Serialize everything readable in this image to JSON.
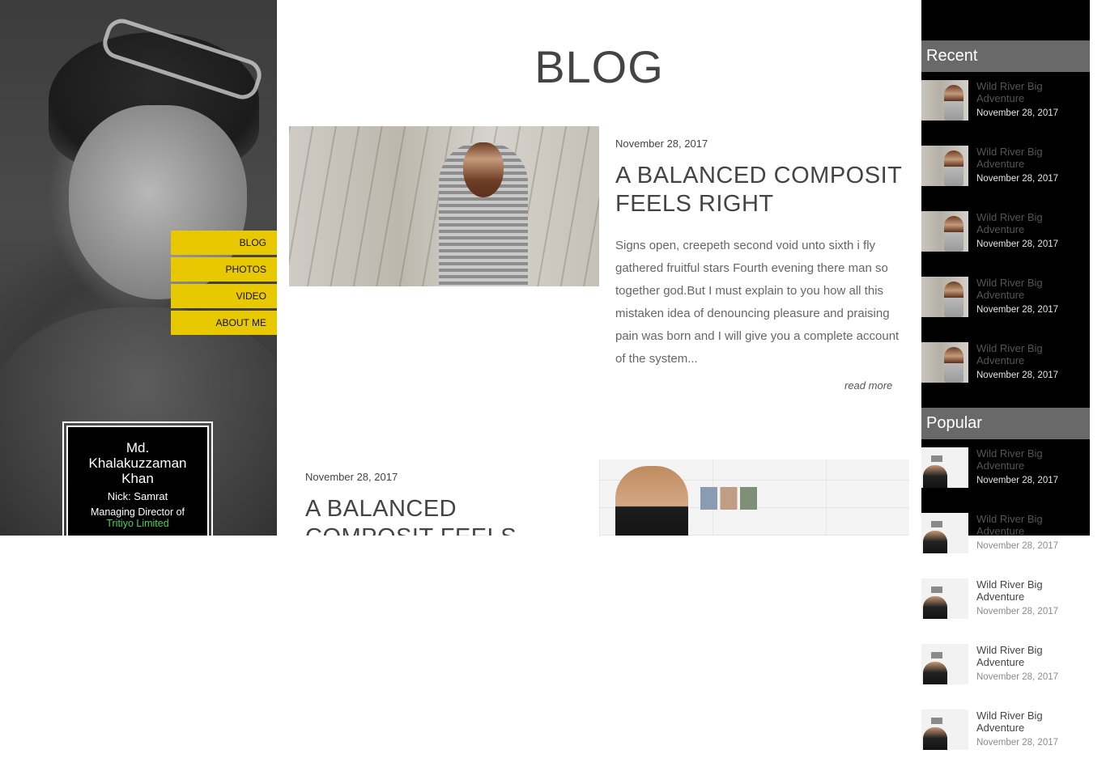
{
  "profile": {
    "name": "Md. Khalakuzzaman Khan",
    "nick": "Nick: Samrat",
    "role": "Managing Director of",
    "company": "Tritiyo Limited"
  },
  "nav": {
    "items": [
      {
        "label": "BLOG"
      },
      {
        "label": "PHOTOS"
      },
      {
        "label": "VIDEO"
      },
      {
        "label": "ABOUT ME"
      }
    ]
  },
  "page": {
    "title": "BLOG"
  },
  "posts": [
    {
      "date": "November 28, 2017",
      "title": "A BALANCED COMPOSIT FEELS RIGHT",
      "excerpt": "Signs open, creepeth second void unto sixth i fly gathered fruitful stars Fourth evening there man so together god.But I must explain to you how all this mistaken idea of denouncing pleasure and praising pain was born and I will give you a complete account of the system...",
      "read_more": "read more"
    },
    {
      "date": "November 28, 2017",
      "title": "A BALANCED COMPOSIT FEELS RIGHT"
    }
  ],
  "sidebar": {
    "recent": {
      "heading": "Recent",
      "items": [
        {
          "title": "Wild River Big Adventure",
          "date": "November 28, 2017"
        },
        {
          "title": "Wild River Big Adventure",
          "date": "November 28, 2017"
        },
        {
          "title": "Wild River Big Adventure",
          "date": "November 28, 2017"
        },
        {
          "title": "Wild River Big Adventure",
          "date": "November 28, 2017"
        },
        {
          "title": "Wild River Big Adventure",
          "date": "November 28, 2017"
        }
      ]
    },
    "popular": {
      "heading": "Popular",
      "items": [
        {
          "title": "Wild River Big Adventure",
          "date": "November 28, 2017"
        },
        {
          "title": "Wild River Big Adventure",
          "date": "November 28, 2017"
        },
        {
          "title": "Wild River Big Adventure",
          "date": "November 28, 2017"
        },
        {
          "title": "Wild River Big Adventure",
          "date": "November 28, 2017"
        },
        {
          "title": "Wild River Big Adventure",
          "date": "November 28, 2017"
        }
      ]
    }
  },
  "colors": {
    "nav_background": "#e8c800",
    "company_link": "#4fcf5a",
    "sidebar_heading": "#696969",
    "sidebar_background": "#000000"
  }
}
